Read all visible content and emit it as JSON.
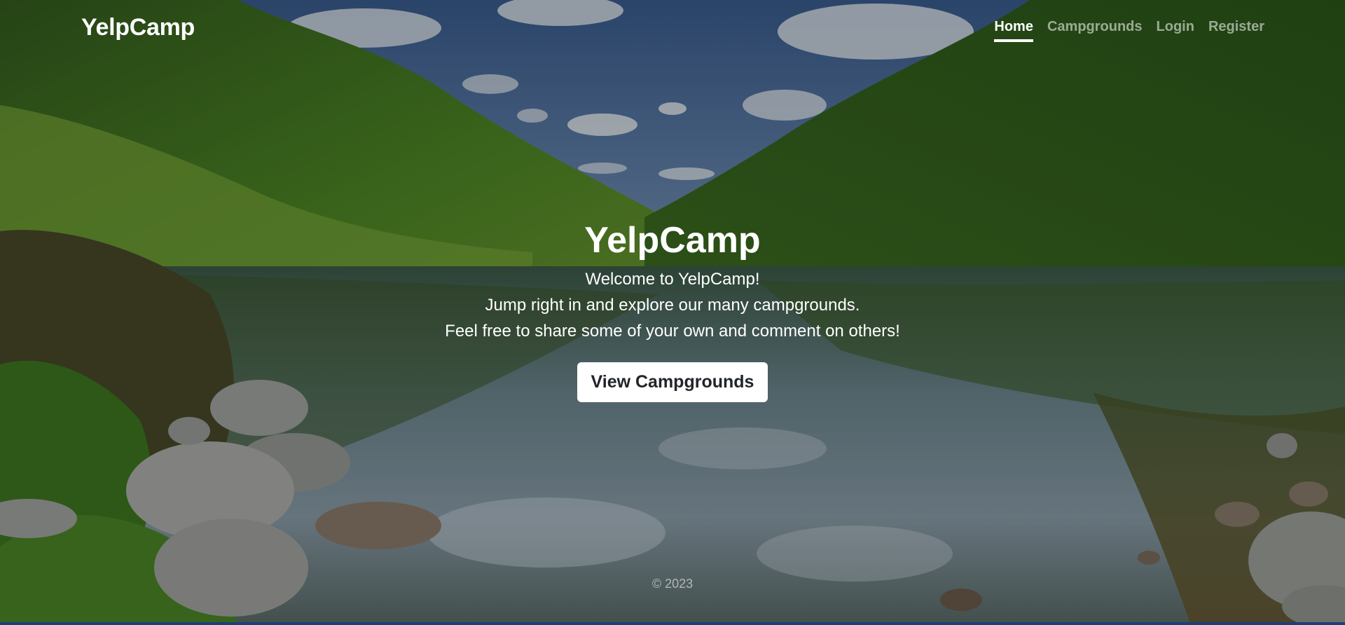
{
  "navbar": {
    "brand": "YelpCamp",
    "links": [
      {
        "label": "Home",
        "active": true
      },
      {
        "label": "Campgrounds",
        "active": false
      },
      {
        "label": "Login",
        "active": false
      },
      {
        "label": "Register",
        "active": false
      }
    ]
  },
  "hero": {
    "title": "YelpCamp",
    "lines": [
      "Welcome to YelpCamp!",
      "Jump right in and explore our many campgrounds.",
      "Feel free to share some of your own and comment on others!"
    ],
    "cta_label": "View Campgrounds"
  },
  "footer": {
    "copyright": "© 2023"
  },
  "colors": {
    "sky": "#4a6f9e",
    "forest": "#2f5a1e",
    "water": "#5f7a80",
    "accent_bottom": "#1b3f7a"
  }
}
